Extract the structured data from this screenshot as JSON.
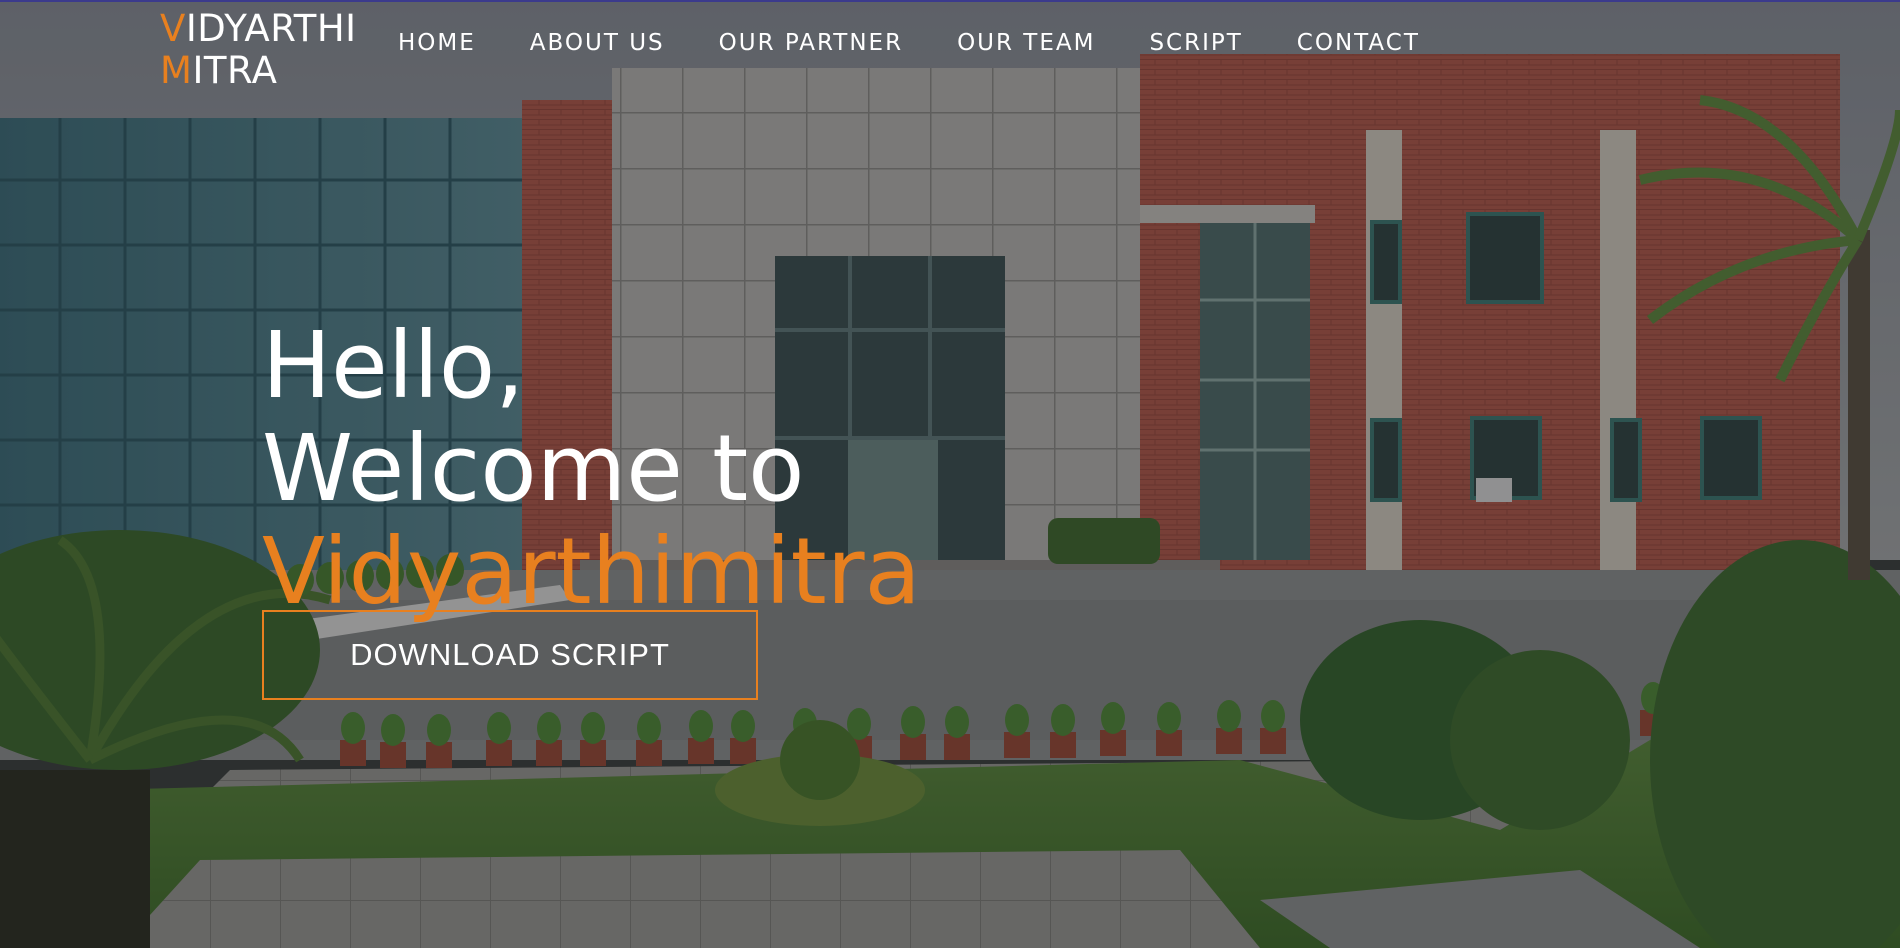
{
  "brand": {
    "line1_initial": "V",
    "line1_rest": "IDYARTHI",
    "line2_initial": "M",
    "line2_rest": "ITRA",
    "accent_color": "#e8801f"
  },
  "nav": {
    "items": [
      {
        "label": "HOME"
      },
      {
        "label": "ABOUT US"
      },
      {
        "label": "OUR PARTNER"
      },
      {
        "label": "OUR TEAM"
      },
      {
        "label": "SCRIPT"
      },
      {
        "label": "CONTACT"
      }
    ]
  },
  "hero": {
    "line1": "Hello,",
    "line2": "Welcome to",
    "line3": "Vidyarthimitra",
    "cta_label": "DOWNLOAD SCRIPT",
    "background": "campus-building-photo"
  }
}
